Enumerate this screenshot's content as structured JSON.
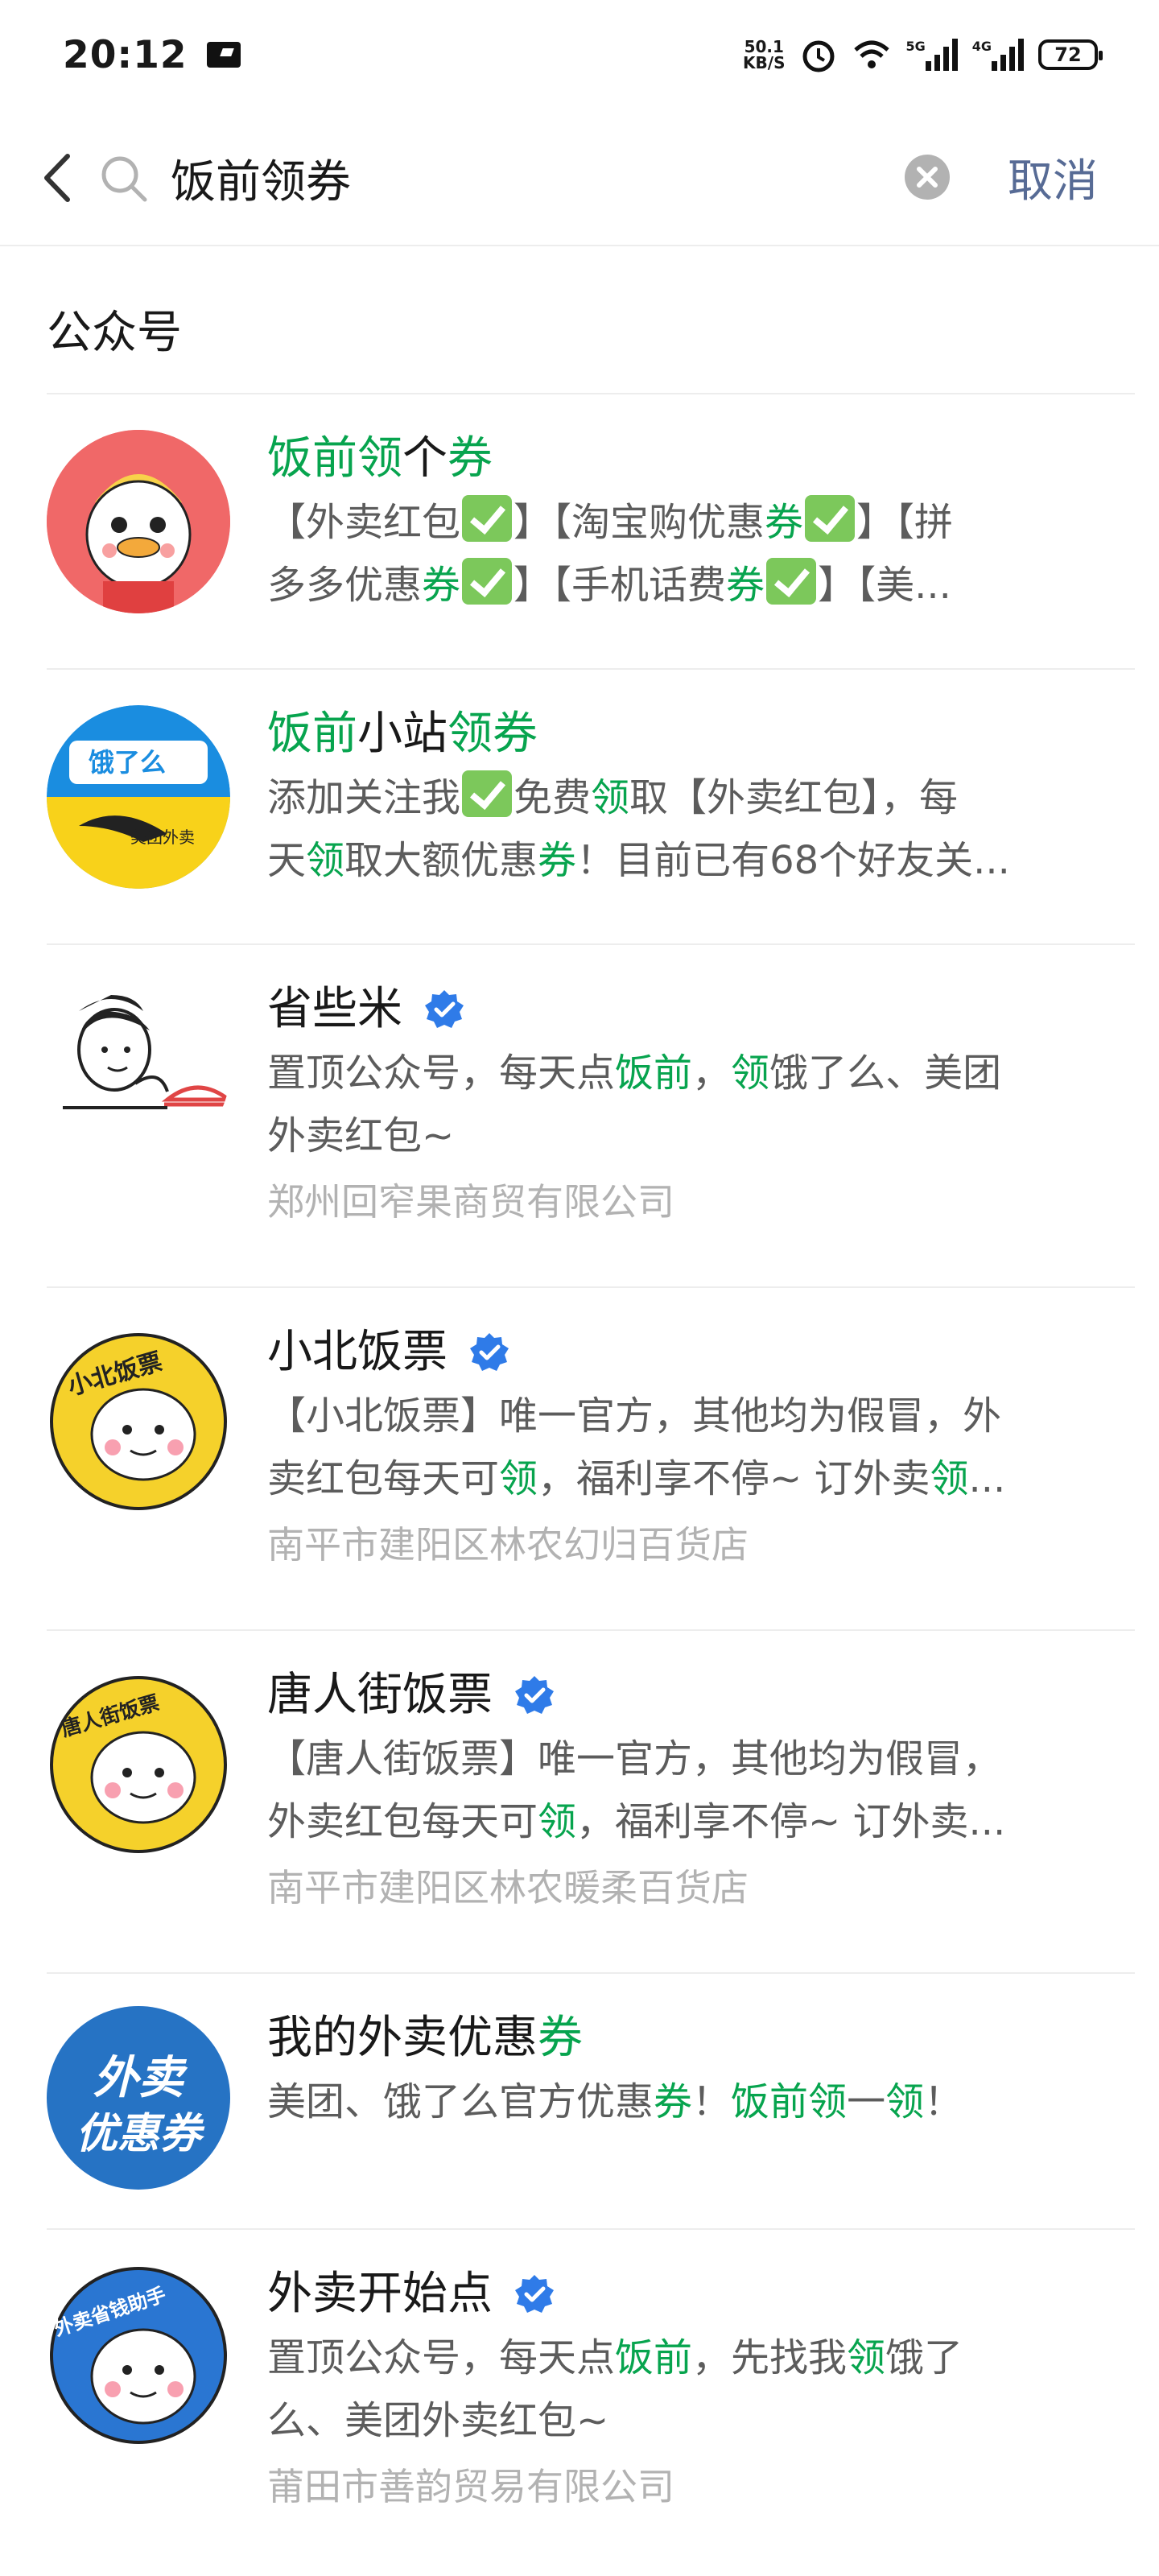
{
  "status_bar": {
    "time": "20:12",
    "net_speed_top": "50.1",
    "net_speed_bottom": "KB/S",
    "sig1_label": "5G",
    "sig2_label": "4G",
    "battery": "72"
  },
  "search": {
    "query": "饭前领券",
    "cancel_label": "取消"
  },
  "section": {
    "title": "公众号"
  },
  "results": [
    {
      "title_parts": [
        [
          "hl",
          "饭前领"
        ],
        [
          "n",
          "个"
        ],
        [
          "hl",
          "券"
        ]
      ],
      "desc_lines": [
        [
          [
            "n",
            "【外卖红包"
          ],
          [
            "chk",
            ""
          ],
          [
            "n",
            "】【淘宝购优惠"
          ],
          [
            "hl",
            "券"
          ],
          [
            "chk",
            ""
          ],
          [
            "n",
            "】【拼"
          ]
        ],
        [
          [
            "n",
            "多多优惠"
          ],
          [
            "hl",
            "券"
          ],
          [
            "chk",
            ""
          ],
          [
            "n",
            "】【手机话费"
          ],
          [
            "hl",
            "券"
          ],
          [
            "chk",
            ""
          ],
          [
            "n",
            "】【美..."
          ]
        ]
      ],
      "verified": false,
      "company": ""
    },
    {
      "title_parts": [
        [
          "hl",
          "饭前"
        ],
        [
          "n",
          "小站"
        ],
        [
          "hl",
          "领券"
        ]
      ],
      "desc_lines": [
        [
          [
            "n",
            "添加关注我"
          ],
          [
            "chk",
            ""
          ],
          [
            "n",
            "免费"
          ],
          [
            "hl",
            "领"
          ],
          [
            "n",
            "取【外卖红包】，每"
          ]
        ],
        [
          [
            "n",
            "天"
          ],
          [
            "hl",
            "领"
          ],
          [
            "n",
            "取大额优惠"
          ],
          [
            "hl",
            "券"
          ],
          [
            "n",
            "！目前已有68个好友关..."
          ]
        ]
      ],
      "verified": false,
      "company": ""
    },
    {
      "title_parts": [
        [
          "n",
          "省些米"
        ]
      ],
      "desc_lines": [
        [
          [
            "n",
            "置顶公众号，每天点"
          ],
          [
            "hl",
            "饭前"
          ],
          [
            "n",
            "，"
          ],
          [
            "hl",
            "领"
          ],
          [
            "n",
            "饿了么、美团"
          ]
        ],
        [
          [
            "n",
            "外卖红包~"
          ]
        ]
      ],
      "verified": true,
      "company": "郑州回窄果商贸有限公司"
    },
    {
      "title_parts": [
        [
          "n",
          "小北饭票"
        ]
      ],
      "desc_lines": [
        [
          [
            "n",
            "【小北饭票】唯一官方，其他均为假冒，外"
          ]
        ],
        [
          [
            "n",
            "卖红包每天可"
          ],
          [
            "hl",
            "领"
          ],
          [
            "n",
            "，福利享不停~ 订外卖"
          ],
          [
            "hl",
            "领"
          ],
          [
            "n",
            "..."
          ]
        ]
      ],
      "verified": true,
      "company": "南平市建阳区林农幻归百货店"
    },
    {
      "title_parts": [
        [
          "n",
          "唐人街饭票"
        ]
      ],
      "desc_lines": [
        [
          [
            "n",
            "【唐人街饭票】唯一官方，其他均为假冒，"
          ]
        ],
        [
          [
            "n",
            "外卖红包每天可"
          ],
          [
            "hl",
            "领"
          ],
          [
            "n",
            "，福利享不停~ 订外卖..."
          ]
        ]
      ],
      "verified": true,
      "company": "南平市建阳区林农暖柔百货店"
    },
    {
      "title_parts": [
        [
          "n",
          "我的外卖优惠"
        ],
        [
          "hl",
          "券"
        ]
      ],
      "desc_lines": [
        [
          [
            "n",
            "美团、饿了么官方优惠"
          ],
          [
            "hl",
            "券"
          ],
          [
            "n",
            "！"
          ],
          [
            "hl",
            "饭前领"
          ],
          [
            "n",
            "一"
          ],
          [
            "hl",
            "领"
          ],
          [
            "n",
            "！"
          ]
        ]
      ],
      "verified": false,
      "company": ""
    },
    {
      "title_parts": [
        [
          "n",
          "外卖开始点"
        ]
      ],
      "desc_lines": [
        [
          [
            "n",
            "置顶公众号，每天点"
          ],
          [
            "hl",
            "饭前"
          ],
          [
            "n",
            "，先找我"
          ],
          [
            "hl",
            "领"
          ],
          [
            "n",
            "饿了"
          ]
        ],
        [
          [
            "n",
            "么、美团外卖红包~"
          ]
        ]
      ],
      "verified": true,
      "company": "莆田市善韵贸易有限公司"
    }
  ],
  "avatars": {
    "a2_text": "饿了么",
    "a2_sub": "美团外卖",
    "a4_text": "小北饭票",
    "a5_text": "唐人街饭票",
    "a6_line1": "外卖",
    "a6_line2": "优惠券",
    "a7_text": "外卖省钱助手"
  },
  "colors": {
    "highlight": "#07a44e",
    "cancel": "#576b95",
    "verified": "#2f7be8"
  }
}
